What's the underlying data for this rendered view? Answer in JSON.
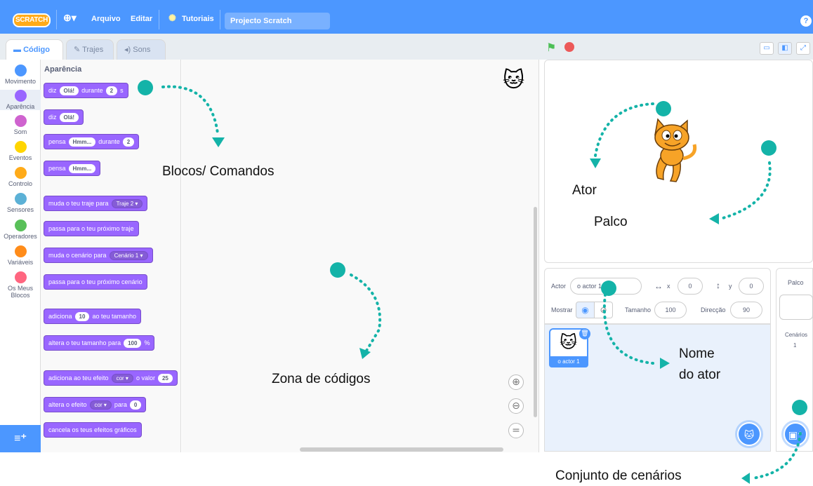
{
  "menubar": {
    "logo": "SCRATCH",
    "language_icon": "globe-icon",
    "file": "Arquivo",
    "edit": "Editar",
    "tutorials": "Tutoriais",
    "project_title": "Projecto Scratch",
    "help": "?"
  },
  "tabs": [
    {
      "label": "Código",
      "icon": "code-icon"
    },
    {
      "label": "Trajes",
      "icon": "brush-icon"
    },
    {
      "label": "Sons",
      "icon": "speaker-icon"
    }
  ],
  "categories": [
    {
      "label": "Movimento",
      "color": "#4c97ff"
    },
    {
      "label": "Aparência",
      "color": "#9966ff"
    },
    {
      "label": "Som",
      "color": "#cf63cf"
    },
    {
      "label": "Eventos",
      "color": "#ffd500"
    },
    {
      "label": "Controlo",
      "color": "#ffab19"
    },
    {
      "label": "Sensores",
      "color": "#5cb1d6"
    },
    {
      "label": "Operadores",
      "color": "#59c059"
    },
    {
      "label": "Variáveis",
      "color": "#ff8c1a"
    },
    {
      "label": "Os Meus Blocos",
      "color": "#ff6680"
    }
  ],
  "palette": {
    "heading": "Aparência",
    "blocks": {
      "say_for": {
        "a": "diz",
        "v1": "Olá!",
        "b": "durante",
        "v2": "2",
        "c": "s"
      },
      "say": {
        "a": "diz",
        "v1": "Olá!"
      },
      "think_for": {
        "a": "pensa",
        "v1": "Hmm...",
        "b": "durante",
        "v2": "2"
      },
      "think": {
        "a": "pensa",
        "v1": "Hmm..."
      },
      "switch_costume": {
        "a": "muda o teu traje para",
        "v1": "Traje 2 ▾"
      },
      "next_costume": {
        "a": "passa para o teu próximo traje"
      },
      "switch_backdrop": {
        "a": "muda o cenário para",
        "v1": "Cenário 1 ▾"
      },
      "next_backdrop": {
        "a": "passa para o teu próximo cenário"
      },
      "change_size": {
        "a": "adiciona",
        "v1": "10",
        "b": "ao teu tamanho"
      },
      "set_size": {
        "a": "altera o teu tamanho para",
        "v1": "100",
        "b": "%"
      },
      "change_effect": {
        "a": "adiciona ao teu efeito",
        "v1": "cor ▾",
        "b": "o valor",
        "v2": "25"
      },
      "set_effect": {
        "a": "altera o efeito",
        "v1": "cor ▾",
        "b": "para",
        "v2": "0"
      },
      "clear_effects": {
        "a": "cancela os teus efeitos gráficos"
      }
    }
  },
  "sprite_info": {
    "actor_label": "Actor",
    "actor_name": "o actor 1",
    "x_label": "x",
    "x_value": "0",
    "y_label": "y",
    "y_value": "0",
    "show_label": "Mostrar",
    "size_label": "Tamanho",
    "size_value": "100",
    "direction_label": "Direcção",
    "direction_value": "90"
  },
  "sprite_list": [
    {
      "name": "o actor 1"
    }
  ],
  "stage_panel": {
    "title": "Palco",
    "backdrops_label": "Cenários",
    "backdrops_count": "1"
  },
  "annotations": {
    "blocks": "Blocos/ Comandos",
    "code_zone": "Zona de códigos",
    "actor": "Ator",
    "stage": "Palco",
    "actor_name_1": "Nome",
    "actor_name_2": "do ator",
    "backdrops_set": "Conjunto de cenários"
  },
  "colors": {
    "accent": "#4c97ff",
    "looks": "#9966ff",
    "annotation_teal": "#14b3a8"
  }
}
